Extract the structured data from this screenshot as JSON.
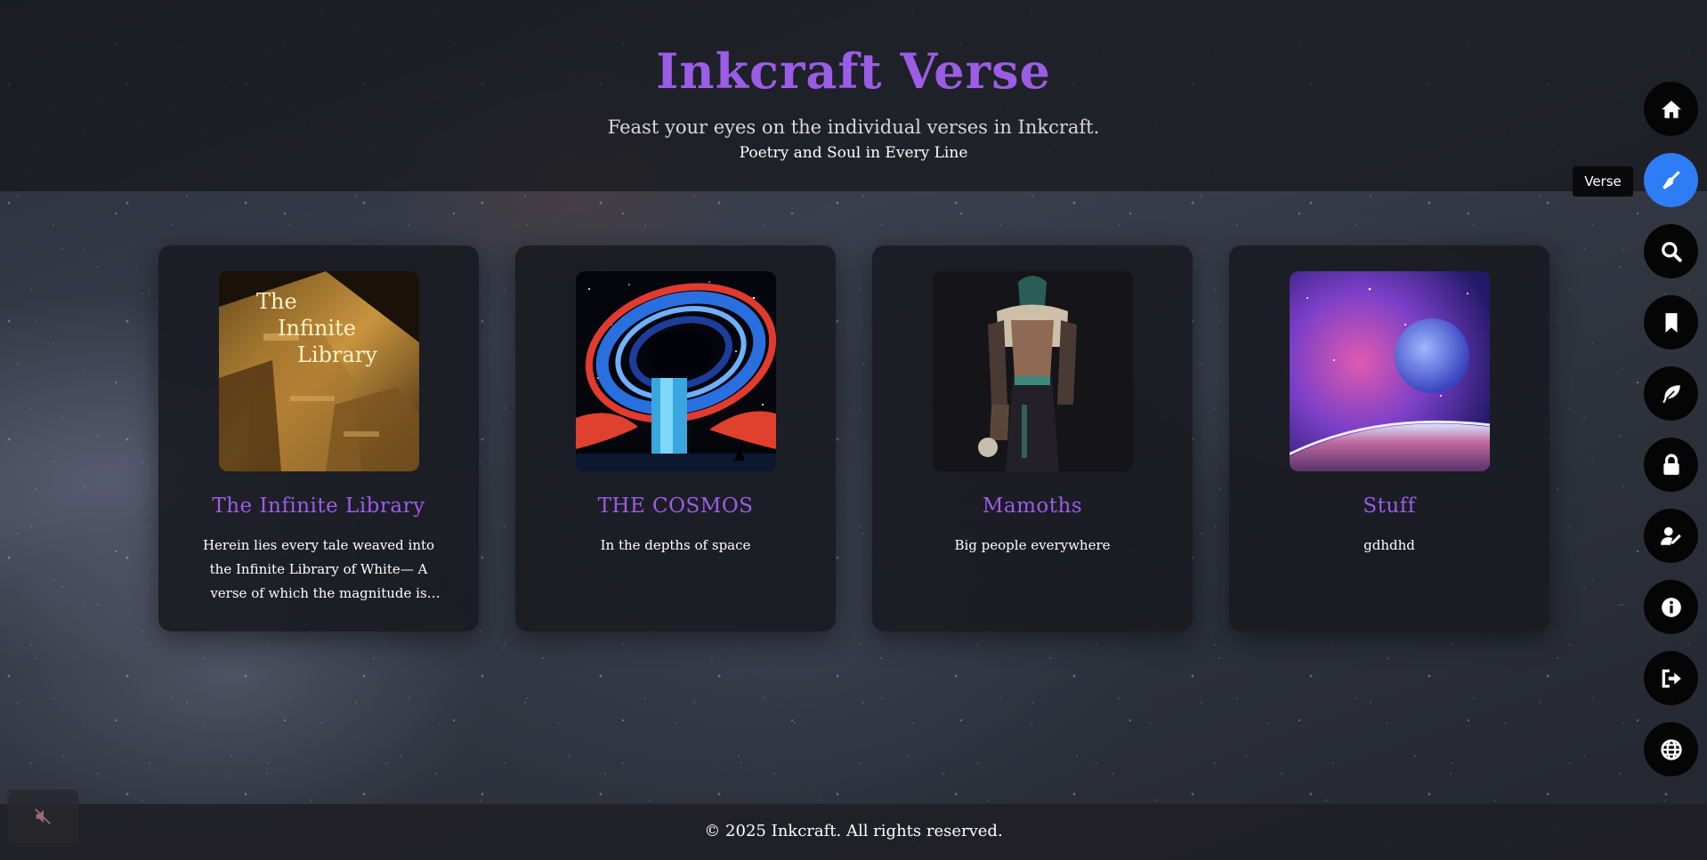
{
  "header": {
    "title": "Inkcraft Verse",
    "tagline": "Feast your eyes on the individual verses in Inkcraft.",
    "subtagline": "Poetry and Soul in Every Line"
  },
  "cards": [
    {
      "title": "The Infinite Library",
      "description": "Herein lies every tale weaved into the Infinite Library of White— A verse of which the magnitude is simply mind-blowing.",
      "image_text": "The Infinite Library"
    },
    {
      "title": "THE COSMOS",
      "description": "In the depths of space"
    },
    {
      "title": "Mamoths",
      "description": "Big people everywhere"
    },
    {
      "title": "Stuff",
      "description": "gdhdhd"
    }
  ],
  "nav": {
    "items": [
      {
        "icon": "home-icon"
      },
      {
        "icon": "pen-nib-icon",
        "active": true
      },
      {
        "icon": "search-icon"
      },
      {
        "icon": "bookmark-icon"
      },
      {
        "icon": "feather-icon"
      },
      {
        "icon": "lock-icon"
      },
      {
        "icon": "user-edit-icon"
      },
      {
        "icon": "info-icon"
      },
      {
        "icon": "sign-out-icon"
      },
      {
        "icon": "globe-icon"
      }
    ],
    "tooltip": "Verse"
  },
  "footer": {
    "copyright": "© 2025 Inkcraft. All rights reserved."
  },
  "colors": {
    "accent": "#9b5de5",
    "active_nav": "#2f7df6"
  }
}
